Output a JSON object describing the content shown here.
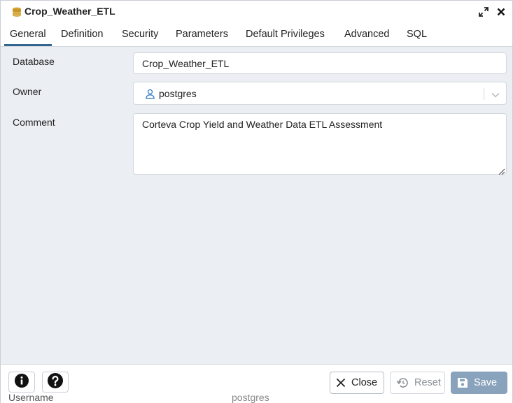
{
  "dialog": {
    "title": "Crop_Weather_ETL",
    "title_icon": "database-icon",
    "maximize_icon": "maximize-icon",
    "close_icon": "close-icon"
  },
  "tabs": [
    {
      "label": "General",
      "active": true
    },
    {
      "label": "Definition"
    },
    {
      "label": "Security"
    },
    {
      "label": "Parameters"
    },
    {
      "label": "Default Privileges"
    },
    {
      "label": "Advanced"
    },
    {
      "label": "SQL"
    }
  ],
  "form": {
    "database": {
      "label": "Database",
      "value": "Crop_Weather_ETL"
    },
    "owner": {
      "label": "Owner",
      "value": "postgres",
      "icon": "user-icon"
    },
    "comment": {
      "label": "Comment",
      "value": "Corteva Crop Yield and Weather Data ETL Assessment"
    }
  },
  "footer": {
    "info_icon": "info-icon",
    "help_icon": "help-icon",
    "close_label": "Close",
    "reset_label": "Reset",
    "save_label": "Save"
  },
  "background": {
    "left_text": "Username",
    "right_text": "postgres"
  },
  "colors": {
    "accent": "#326690",
    "save_button": "#8aa3bd",
    "database_icon": "#d7a530"
  }
}
